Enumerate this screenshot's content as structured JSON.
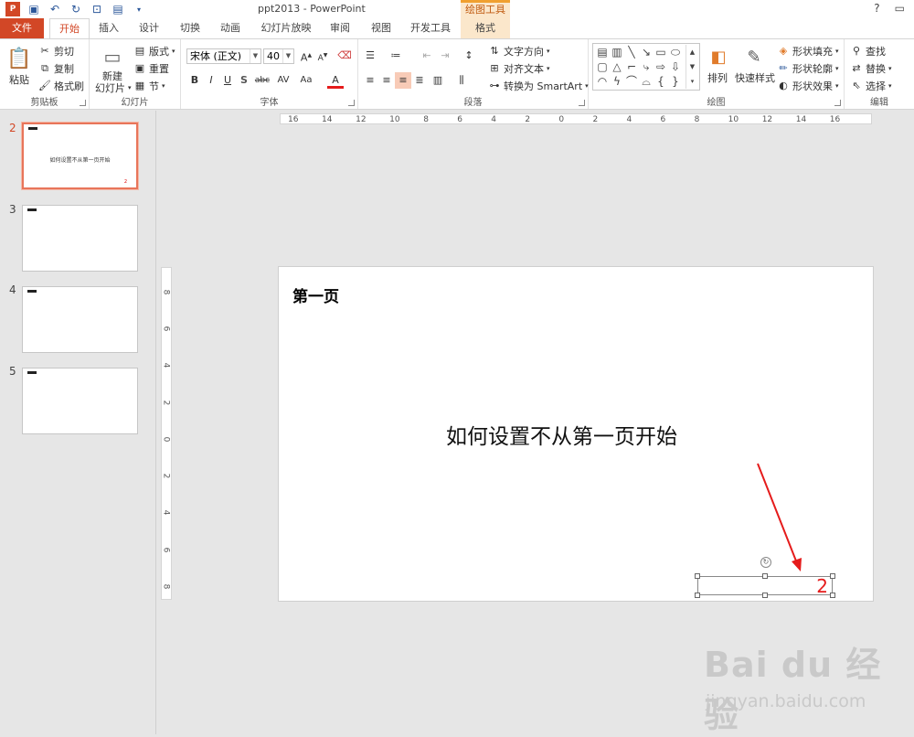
{
  "window": {
    "title": "ppt2013 - PowerPoint",
    "context_group": "绘图工具",
    "help": "?"
  },
  "tabs": [
    "文件",
    "开始",
    "插入",
    "设计",
    "切换",
    "动画",
    "幻灯片放映",
    "审阅",
    "视图",
    "开发工具",
    "格式"
  ],
  "ribbon": {
    "clipboard": {
      "label": "剪贴板",
      "paste": "粘贴",
      "cut": "剪切",
      "copy": "复制",
      "painter": "格式刷"
    },
    "slides": {
      "label": "幻灯片",
      "new_line1": "新建",
      "new_line2": "幻灯片",
      "layout": "版式",
      "reset": "重置",
      "section": "节"
    },
    "font": {
      "label": "字体",
      "name": "宋体 (正文)",
      "size": "40",
      "bold": "B",
      "italic": "I",
      "underline": "U",
      "shadow": "S",
      "strike": "abc",
      "spacing": "AV",
      "case": "Aa",
      "color": "A"
    },
    "paragraph": {
      "label": "段落",
      "text_dir": "文字方向",
      "align_text": "对齐文本",
      "smartart": "转换为 SmartArt"
    },
    "drawing": {
      "label": "绘图",
      "arrange": "排列",
      "quick_styles": "快速样式",
      "fill": "形状填充",
      "outline": "形状轮廓",
      "effects": "形状效果"
    },
    "editing": {
      "label": "编辑",
      "find": "查找",
      "replace": "替换",
      "select": "选择"
    }
  },
  "ruler_h": [
    "16",
    "14",
    "12",
    "10",
    "8",
    "6",
    "4",
    "2",
    "0",
    "2",
    "4",
    "6",
    "8",
    "10",
    "12",
    "14",
    "16"
  ],
  "ruler_v": [
    "8",
    "6",
    "4",
    "2",
    "0",
    "2",
    "4",
    "6",
    "8"
  ],
  "thumbnails": [
    {
      "num": "2",
      "main": "如何设置不从第一页开始",
      "pnum": "2"
    },
    {
      "num": "3"
    },
    {
      "num": "4"
    },
    {
      "num": "5"
    }
  ],
  "slide": {
    "title": "第一页",
    "body": "如何设置不从第一页开始",
    "number": "2"
  },
  "watermark": {
    "brand": "Bai du 经验",
    "url": "jingyan.baidu.com"
  },
  "colors": {
    "accent": "#d24726",
    "annotation": "#e51b1b"
  }
}
